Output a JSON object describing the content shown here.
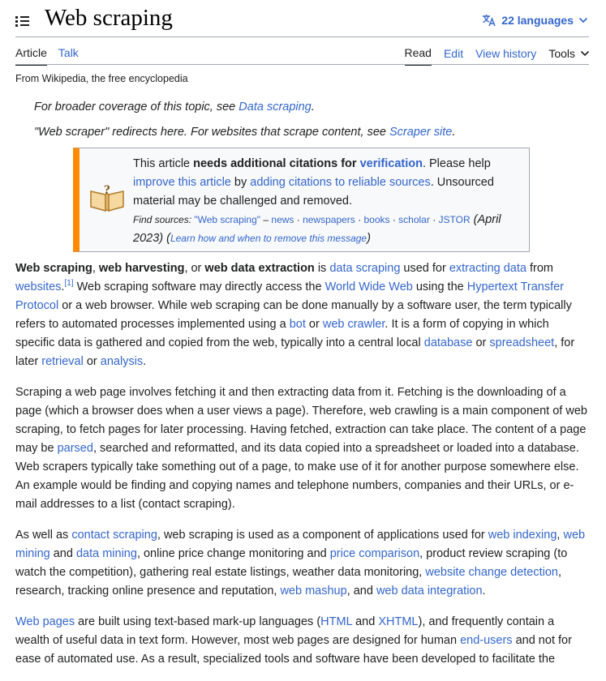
{
  "header": {
    "title": "Web scraping",
    "languages_label": "22 languages"
  },
  "tabs": {
    "article": "Article",
    "talk": "Talk",
    "read": "Read",
    "edit": "Edit",
    "view_history": "View history",
    "tools": "Tools"
  },
  "tagline": "From Wikipedia, the free encyclopedia",
  "hatnotes": {
    "h1_pre": "For broader coverage of this topic, see ",
    "h1_link": "Data scraping",
    "h1_post": ".",
    "h2_pre": "\"Web scraper\" redirects here. For websites that scrape content, see ",
    "h2_link": "Scraper site",
    "h2_post": "."
  },
  "ambox": {
    "t1": "This article ",
    "t2": "needs additional citations for ",
    "t3": "verification",
    "t4": ". Please help ",
    "t5": "improve this article",
    "t6": " by ",
    "t7": "adding citations to reliable sources",
    "t8": ". Unsourced material may be challenged and removed.",
    "find": "Find sources: ",
    "q": "\"Web scraping\"",
    "dash": " – ",
    "news": "news",
    "newspapers": "newspapers",
    "books": "books",
    "scholar": "scholar",
    "jstor": "JSTOR",
    "date": " (April 2023)",
    "open": " (",
    "learn": "Learn how and when to remove this message",
    "close": ")"
  },
  "p1": {
    "b1": "Web scraping",
    "c1": ", ",
    "b2": "web harvesting",
    "c2": ", or ",
    "b3": "web data extraction",
    "s1": " is ",
    "l1": "data scraping",
    "s2": " used for ",
    "l2": "extracting data",
    "s3": " from ",
    "l3": "websites",
    "cite": "[1]",
    "s4": " Web scraping software may directly access the ",
    "l4": "World Wide Web",
    "s5": " using the ",
    "l5": "Hypertext Transfer Protocol",
    "s6": " or a web browser. While web scraping can be done manually by a software user, the term typically refers to automated processes implemented using a ",
    "l6": "bot",
    "s7": " or ",
    "l7": "web crawler",
    "s8": ". It is a form of copying in which specific data is gathered and copied from the web, typically into a central local ",
    "l8": "database",
    "s9": " or ",
    "l9": "spreadsheet",
    "s10": ", for later ",
    "l10": "retrieval",
    "s11": " or ",
    "l11": "analysis",
    "s12": "."
  },
  "p2": {
    "s1": "Scraping a web page involves fetching it and then extracting data from it. Fetching is the downloading of a page (which a browser does when a user views a page). Therefore, web crawling is a main component of web scraping, to fetch pages for later processing. Having fetched, extraction can take place. The content of a page may be ",
    "l1": "parsed",
    "s2": ", searched and reformatted, and its data copied into a spreadsheet or loaded into a database. Web scrapers typically take something out of a page, to make use of it for another purpose somewhere else. An example would be finding and copying names and telephone numbers, companies and their URLs, or e-mail addresses to a list (contact scraping)."
  },
  "p3": {
    "s1": "As well as ",
    "l1": "contact scraping",
    "s2": ", web scraping is used as a component of applications used for ",
    "l2": "web indexing",
    "s3": ", ",
    "l3": "web mining",
    "s4": " and ",
    "l4": "data mining",
    "s5": ", online price change monitoring and ",
    "l5": "price comparison",
    "s6": ", product review scraping (to watch the competition), gathering real estate listings, weather data monitoring, ",
    "l6": "website change detection",
    "s7": ", research, tracking online presence and reputation, ",
    "l7": "web mashup",
    "s8": ", and ",
    "l8": "web data integration",
    "s9": "."
  },
  "p4": {
    "l1": "Web pages",
    "s1": " are built using text-based mark-up languages (",
    "l2": "HTML",
    "s2": " and ",
    "l3": "XHTML",
    "s3": "), and frequently contain a wealth of useful data in text form. However, most web pages are designed for human ",
    "l4": "end-users",
    "s4": " and not for ease of automated use. As a result, specialized tools and software have been developed to facilitate the"
  }
}
